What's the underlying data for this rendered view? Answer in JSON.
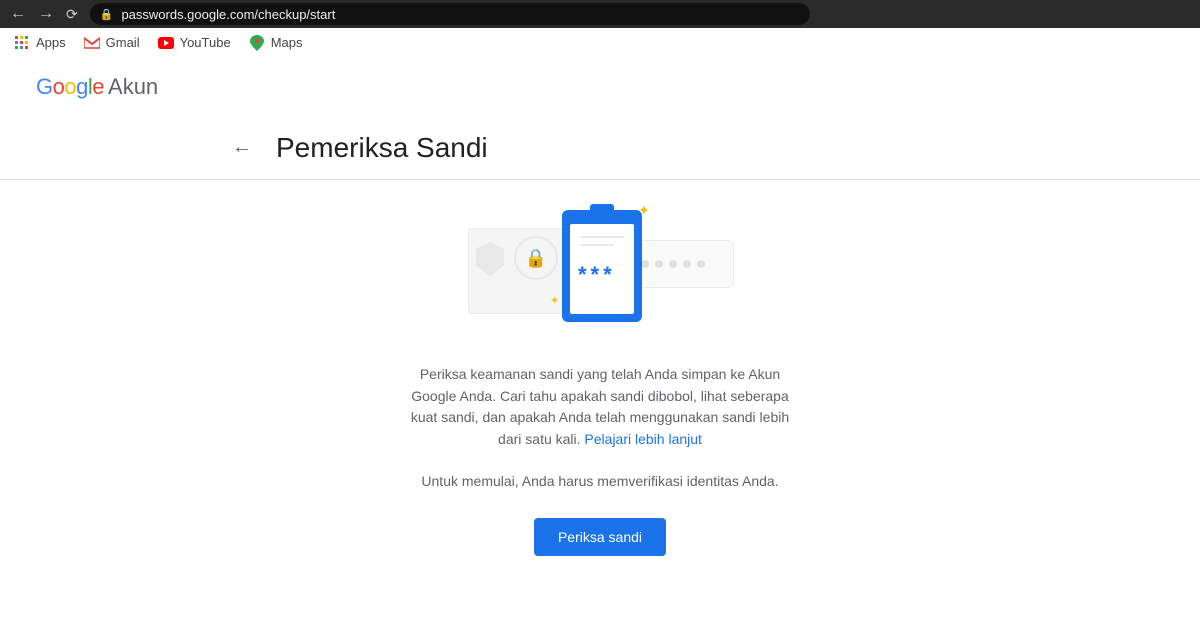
{
  "browser": {
    "url": "passwords.google.com/checkup/start"
  },
  "bookmarks": {
    "apps": "Apps",
    "gmail": "Gmail",
    "youtube": "YouTube",
    "maps": "Maps"
  },
  "header": {
    "product": "Akun"
  },
  "page": {
    "title": "Pemeriksa Sandi",
    "description": "Periksa keamanan sandi yang telah Anda simpan ke Akun Google Anda. Cari tahu apakah sandi dibobol, lihat seberapa kuat sandi, dan apakah Anda telah menggunakan sandi lebih dari satu kali.",
    "learn_more": "Pelajari lebih lanjut",
    "verify_text": "Untuk memulai, Anda harus memverifikasi identitas Anda.",
    "cta_label": "Periksa sandi"
  },
  "illustration": {
    "stars": "***"
  }
}
